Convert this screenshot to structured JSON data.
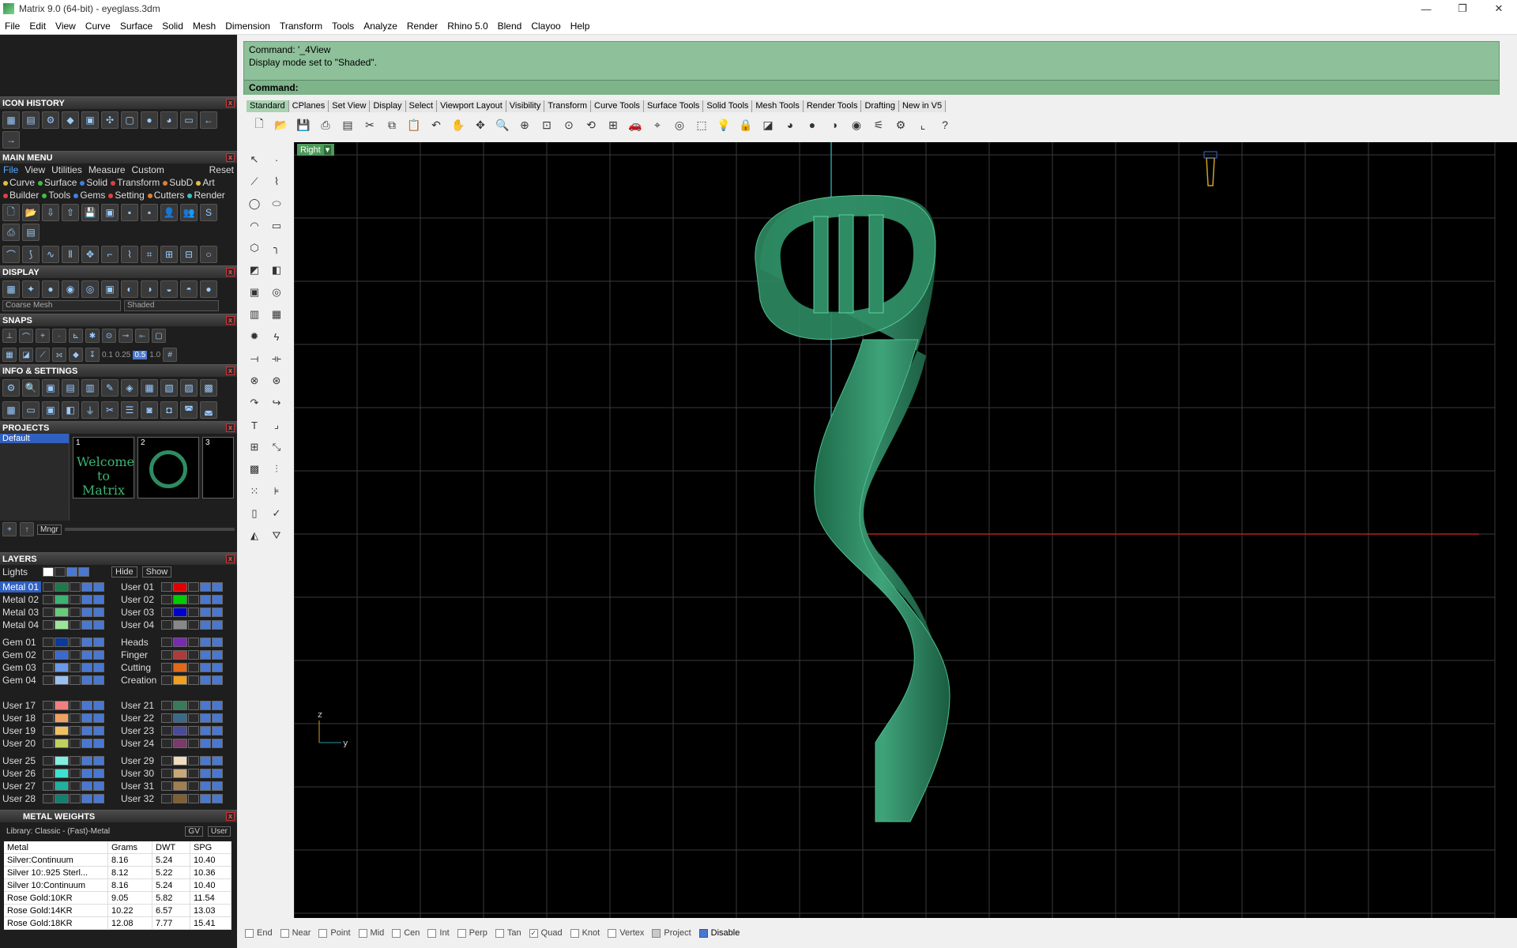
{
  "window": {
    "title": "Matrix 9.0 (64-bit) - eyeglass.3dm",
    "minimize": "—",
    "maximize": "❐",
    "close": "✕"
  },
  "menubar": [
    "File",
    "Edit",
    "View",
    "Curve",
    "Surface",
    "Solid",
    "Mesh",
    "Dimension",
    "Transform",
    "Tools",
    "Analyze",
    "Render",
    "Rhino 5.0",
    "Blend",
    "Clayoo",
    "Help"
  ],
  "panels": {
    "icon_history": {
      "title": "ICON HISTORY"
    },
    "main_menu": {
      "title": "MAIN MENU",
      "row1": [
        "File",
        "View",
        "Utilities",
        "Measure",
        "Custom"
      ],
      "reset": "Reset",
      "row2": [
        "Curve",
        "Surface",
        "Solid",
        "Transform",
        "SubD",
        "Art"
      ],
      "row3": [
        "Builder",
        "Tools",
        "Gems",
        "Setting",
        "Cutters",
        "Render"
      ]
    },
    "display": {
      "title": "DISPLAY",
      "mesh_select": "Coarse Mesh",
      "mode_select": "Shaded"
    },
    "snaps": {
      "title": "SNAPS",
      "values": [
        "0.1",
        "0.25",
        "0.5",
        "1.0"
      ]
    },
    "info_settings": {
      "title": "INFO & SETTINGS"
    },
    "projects": {
      "title": "PROJECTS",
      "default": "Default",
      "thumbs": [
        {
          "num": "1",
          "text": "Welcome to Matrix"
        },
        {
          "num": "2",
          "text": ""
        },
        {
          "num": "3",
          "text": ""
        }
      ],
      "mngr": "Mngr"
    },
    "layers": {
      "title": "LAYERS",
      "lights": "Lights",
      "hide": "Hide",
      "show": "Show",
      "left_group1": [
        {
          "name": "Metal 01",
          "color": "#1f7a4a",
          "active": true
        },
        {
          "name": "Metal 02",
          "color": "#3cb371"
        },
        {
          "name": "Metal 03",
          "color": "#66cc77"
        },
        {
          "name": "Metal 04",
          "color": "#99e699"
        }
      ],
      "right_group1": [
        {
          "name": "User 01",
          "color": "#e00000"
        },
        {
          "name": "User 02",
          "color": "#00cc00"
        },
        {
          "name": "User 03",
          "color": "#0000cc"
        },
        {
          "name": "User 04",
          "color": "#888888"
        }
      ],
      "left_group2": [
        {
          "name": "Gem 01",
          "color": "#0a3a9a"
        },
        {
          "name": "Gem 02",
          "color": "#3a6ad0"
        },
        {
          "name": "Gem 03",
          "color": "#6a9ae8"
        },
        {
          "name": "Gem 04",
          "color": "#9ac0f0"
        }
      ],
      "right_group2": [
        {
          "name": "Heads",
          "color": "#7a2ab0"
        },
        {
          "name": "Finger",
          "color": "#b03a3a"
        },
        {
          "name": "Cutting",
          "color": "#e06a1a"
        },
        {
          "name": "Creation",
          "color": "#f0a020"
        }
      ],
      "left_group3": [
        {
          "name": "User 17",
          "color": "#f08080"
        },
        {
          "name": "User 18",
          "color": "#f0a060"
        },
        {
          "name": "User 19",
          "color": "#f0c060"
        },
        {
          "name": "User 20",
          "color": "#c0d060"
        }
      ],
      "right_group3": [
        {
          "name": "User 21",
          "color": "#3a7a5a"
        },
        {
          "name": "User 22",
          "color": "#3a6a8a"
        },
        {
          "name": "User 23",
          "color": "#4a4a9a"
        },
        {
          "name": "User 24",
          "color": "#7a3a6a"
        }
      ],
      "left_group4": [
        {
          "name": "User 25",
          "color": "#80f0e0"
        },
        {
          "name": "User 26",
          "color": "#40e0d0"
        },
        {
          "name": "User 27",
          "color": "#20b0a0"
        },
        {
          "name": "User 28",
          "color": "#108070"
        }
      ],
      "right_group4": [
        {
          "name": "User 29",
          "color": "#f0dcc0"
        },
        {
          "name": "User 30",
          "color": "#c8a878"
        },
        {
          "name": "User 31",
          "color": "#a08050"
        },
        {
          "name": "User 32",
          "color": "#806030"
        }
      ]
    },
    "metal_weights": {
      "title": "METAL WEIGHTS",
      "library": "Library: Classic - (Fast)-Metal",
      "gv": "GV",
      "user": "User",
      "headers": [
        "Metal",
        "Grams",
        "DWT",
        "SPG"
      ],
      "rows": [
        [
          "Silver:Continuum",
          "8.16",
          "5.24",
          "10.40"
        ],
        [
          "Silver 10:.925 Sterl...",
          "8.12",
          "5.22",
          "10.36"
        ],
        [
          "Silver 10:Continuum",
          "8.16",
          "5.24",
          "10.40"
        ],
        [
          "Rose Gold:10KR",
          "9.05",
          "5.82",
          "11.54"
        ],
        [
          "Rose Gold:14KR",
          "10.22",
          "6.57",
          "13.03"
        ],
        [
          "Rose Gold:18KR",
          "12.08",
          "7.77",
          "15.41"
        ]
      ]
    }
  },
  "command": {
    "history": [
      "Command: '_4View",
      "Display mode set to \"Shaded\"."
    ],
    "prompt": "Command:"
  },
  "tabs": [
    "Standard",
    "CPlanes",
    "Set View",
    "Display",
    "Select",
    "Viewport Layout",
    "Visibility",
    "Transform",
    "Curve Tools",
    "Surface Tools",
    "Solid Tools",
    "Mesh Tools",
    "Render Tools",
    "Drafting",
    "New in V5"
  ],
  "viewport": {
    "label": "Right",
    "axis_z": "z",
    "axis_y": "y",
    "object_color": "#2e8b63"
  },
  "statusbar": {
    "snaps": [
      {
        "label": "End",
        "checked": false
      },
      {
        "label": "Near",
        "checked": false
      },
      {
        "label": "Point",
        "checked": false
      },
      {
        "label": "Mid",
        "checked": false
      },
      {
        "label": "Cen",
        "checked": false
      },
      {
        "label": "Int",
        "checked": false
      },
      {
        "label": "Perp",
        "checked": false
      },
      {
        "label": "Tan",
        "checked": false
      },
      {
        "label": "Quad",
        "checked": true
      },
      {
        "label": "Knot",
        "checked": false
      },
      {
        "label": "Vertex",
        "checked": false
      },
      {
        "label": "Project",
        "checked": false
      },
      {
        "label": "Disable",
        "checked": false
      }
    ]
  }
}
